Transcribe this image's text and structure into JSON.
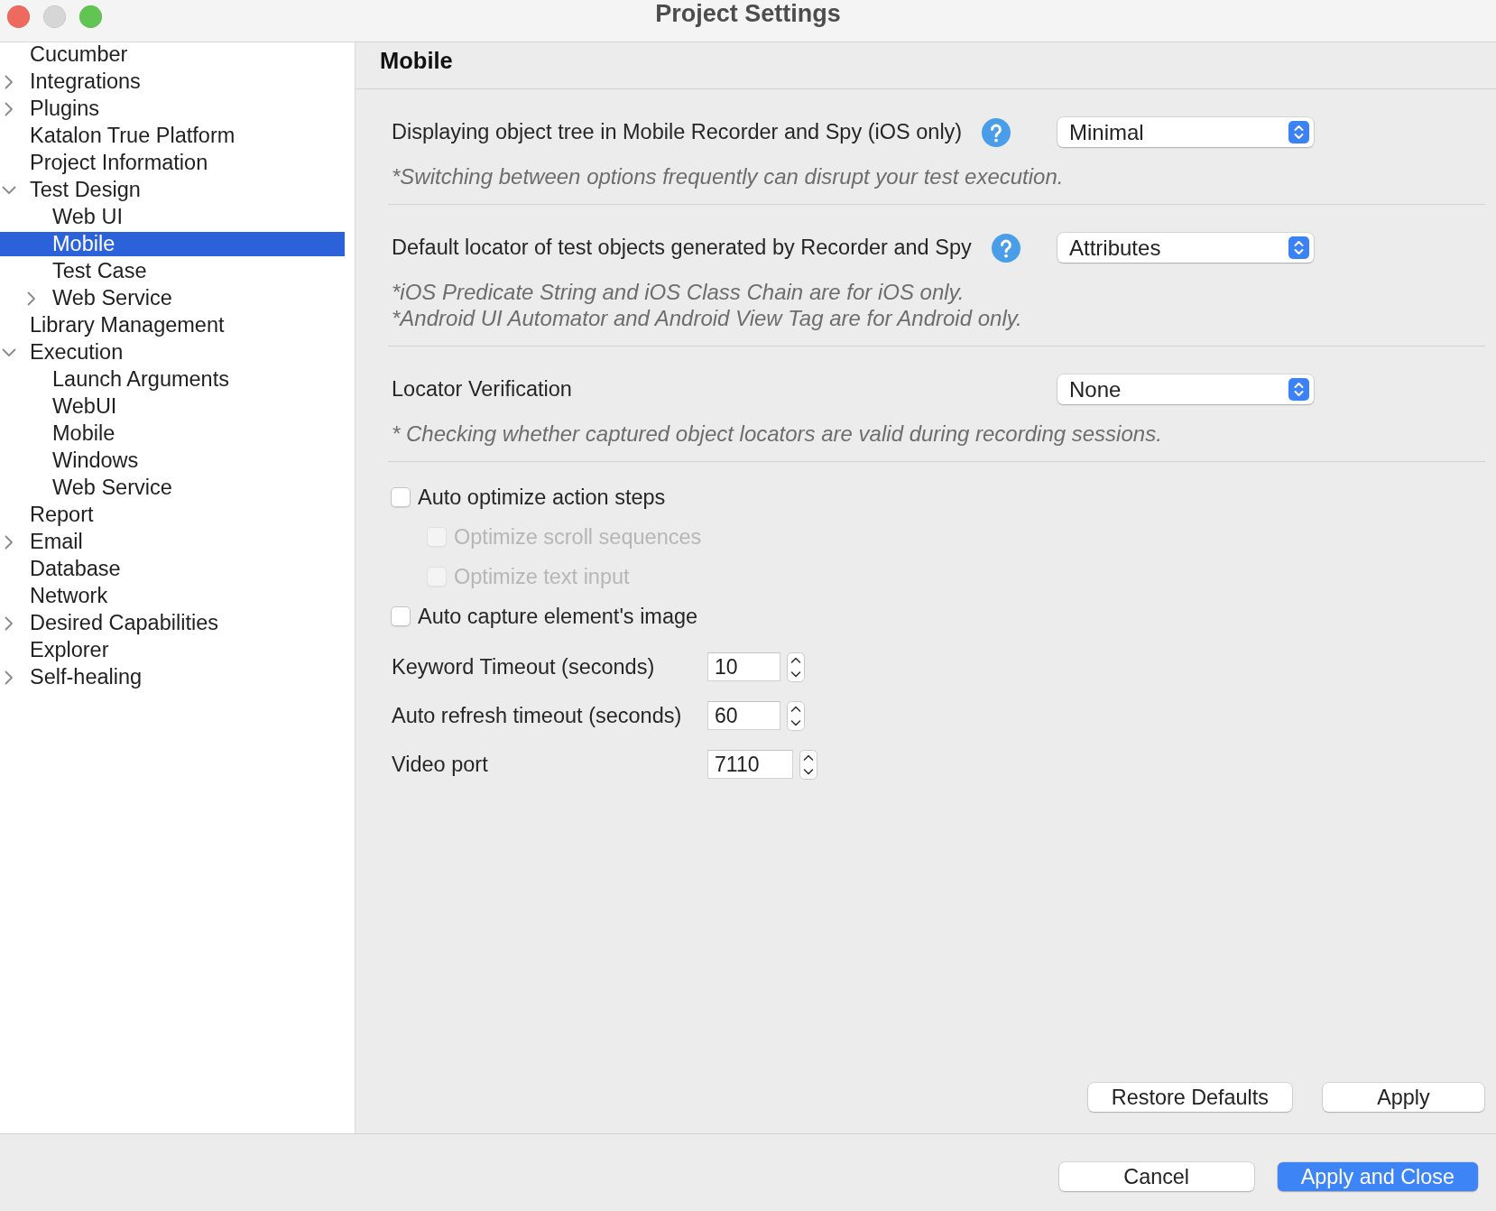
{
  "window": {
    "title": "Project Settings",
    "buttons": [
      {
        "kind": "close",
        "disabled": false
      },
      {
        "kind": "minimize",
        "disabled": true
      },
      {
        "kind": "zoom",
        "disabled": false
      }
    ]
  },
  "sidebar": {
    "items": [
      {
        "label": "Cucumber",
        "selected": false
      },
      {
        "label": "Integrations",
        "selected": false,
        "expanded": false
      },
      {
        "label": "Plugins",
        "selected": false,
        "expanded": false
      },
      {
        "label": "Katalon True Platform",
        "selected": false
      },
      {
        "label": "Project Information",
        "selected": false
      },
      {
        "label": "Test Design",
        "selected": false,
        "expanded": true,
        "children": [
          {
            "label": "Web UI",
            "selected": false
          },
          {
            "label": "Mobile",
            "selected": true
          },
          {
            "label": "Test Case",
            "selected": false
          },
          {
            "label": "Web Service",
            "selected": false,
            "expanded": false
          }
        ]
      },
      {
        "label": "Library Management",
        "selected": false
      },
      {
        "label": "Execution",
        "selected": false,
        "expanded": true,
        "children": [
          {
            "label": "Launch Arguments",
            "selected": false
          },
          {
            "label": "WebUI",
            "selected": false
          },
          {
            "label": "Mobile",
            "selected": false
          },
          {
            "label": "Windows",
            "selected": false
          },
          {
            "label": "Web Service",
            "selected": false
          }
        ]
      },
      {
        "label": "Report",
        "selected": false
      },
      {
        "label": "Email",
        "selected": false,
        "expanded": false
      },
      {
        "label": "Database",
        "selected": false
      },
      {
        "label": "Network",
        "selected": false
      },
      {
        "label": "Desired Capabilities",
        "selected": false,
        "expanded": false
      },
      {
        "label": "Explorer",
        "selected": false
      },
      {
        "label": "Self-healing",
        "selected": false,
        "expanded": false
      }
    ]
  },
  "content": {
    "title": "Mobile",
    "settings": [
      {
        "label": "Displaying object tree in Mobile Recorder and Spy (iOS only)",
        "help": true,
        "value": "Minimal",
        "notes": [
          "*Switching between options frequently can disrupt your test execution."
        ]
      },
      {
        "label": "Default locator of test objects generated by Recorder and Spy",
        "help": true,
        "value": "Attributes",
        "notes": [
          "*iOS Predicate String and iOS Class Chain are for iOS only.",
          "*Android UI Automator and Android View Tag are for Android only."
        ]
      },
      {
        "label": "Locator Verification",
        "help": false,
        "value": "None",
        "notes": [
          "* Checking whether captured object locators are valid during recording sessions."
        ]
      }
    ],
    "options": [
      {
        "label": "Auto optimize action steps",
        "checked": false,
        "disabled": false,
        "children": [
          {
            "label": "Optimize scroll sequences",
            "checked": false,
            "disabled": true
          },
          {
            "label": "Optimize text input",
            "checked": false,
            "disabled": true
          }
        ]
      },
      {
        "label": "Auto capture element's image",
        "checked": false,
        "disabled": false
      }
    ],
    "fields": [
      {
        "label": "Keyword Timeout (seconds)",
        "value": "10"
      },
      {
        "label": "Auto refresh timeout (seconds)",
        "value": "60"
      },
      {
        "label": "Video port",
        "value": "7110"
      }
    ],
    "buttons": [
      "Restore Defaults",
      "Apply"
    ]
  },
  "footer": {
    "buttons": [
      {
        "label": "Cancel",
        "primary": false
      },
      {
        "label": "Apply and Close",
        "primary": true
      }
    ]
  }
}
